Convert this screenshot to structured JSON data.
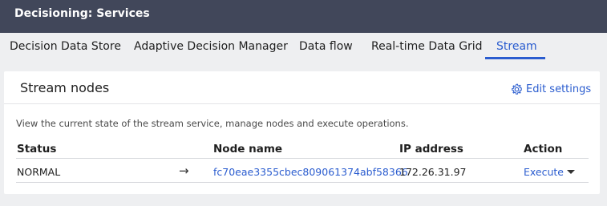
{
  "header": {
    "title": "Decisioning: Services"
  },
  "tabs": [
    {
      "label": "Decision Data Store"
    },
    {
      "label": "Adaptive Decision Manager"
    },
    {
      "label": "Data flow"
    },
    {
      "label": "Real-time Data Grid"
    },
    {
      "label": "Stream",
      "active": true
    }
  ],
  "panel": {
    "title": "Stream nodes",
    "edit_settings_label": "Edit settings",
    "edit_settings_icon": "gear-icon",
    "description": "View the current state of the stream service, manage nodes and execute operations."
  },
  "table": {
    "columns": [
      "Status",
      "Node name",
      "IP address",
      "Action"
    ],
    "rows": [
      {
        "status": "NORMAL",
        "arrow": "→",
        "node_name": "fc70eae3355cbec809061374abf58366",
        "ip_address": "172.26.31.97",
        "action": "Execute"
      }
    ]
  },
  "colors": {
    "header_bg": "#41475a",
    "accent": "#2a5ccf",
    "page_bg": "#eeeff1"
  }
}
